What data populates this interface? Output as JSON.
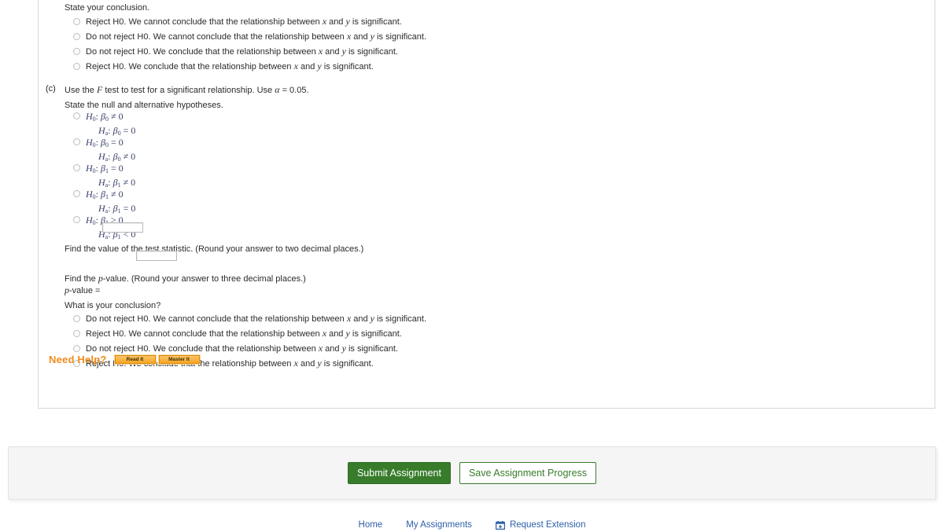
{
  "question": {
    "part_b_prompt": "State your conclusion.",
    "part_b_options": [
      "Reject H0. We cannot conclude that the relationship between x and y is significant.",
      "Do not reject H0. We cannot conclude that the relationship between x and y is significant.",
      "Do not reject H0. We conclude that the relationship between x and y is significant.",
      "Reject H0. We conclude that the relationship between x and y is significant."
    ],
    "part_c_letter": "(c)",
    "part_c_prompt": "Use the F test to test for a significant relationship. Use α = 0.05.",
    "hypotheses_prompt": "State the null and alternative hypotheses.",
    "hypotheses_options": [
      {
        "null": "H0: β0 ≠ 0",
        "alt": "Ha: β0 = 0"
      },
      {
        "null": "H0: β0 = 0",
        "alt": "Ha: β0 ≠ 0"
      },
      {
        "null": "H0: β1 = 0",
        "alt": "Ha: β1 ≠ 0"
      },
      {
        "null": "H0: β1 ≠ 0",
        "alt": "Ha: β1 = 0"
      },
      {
        "null": "H0: β1 ≥ 0",
        "alt": "Ha: β1 < 0"
      }
    ],
    "test_statistic_prompt": "Find the value of the test statistic. (Round your answer to two decimal places.)",
    "test_statistic_value": "",
    "p_value_prompt": "Find the p-value. (Round your answer to three decimal places.)",
    "p_value_label": "p-value =",
    "p_value": "",
    "conclusion_prompt": "What is your conclusion?",
    "conclusion_options": [
      "Do not reject H0. We cannot conclude that the relationship between x and y is significant.",
      "Reject H0. We cannot conclude that the relationship between x and y is significant.",
      "Do not reject H0. We conclude that the relationship between x and y is significant.",
      "Reject H0. We conclude that the relationship between x and y is significant."
    ]
  },
  "help": {
    "label": "Need Help?",
    "read_it": "Read It",
    "master_it": "Master It"
  },
  "actions": {
    "submit": "Submit Assignment",
    "save": "Save Assignment Progress"
  },
  "footer": {
    "home": "Home",
    "my_assignments": "My Assignments",
    "request_extension": "Request Extension",
    "calendar_icon": "calendar-plus-icon"
  },
  "colors": {
    "help_orange": "#f08c1a",
    "submit_green": "#387c2b",
    "link_blue": "#2c5fa8",
    "hypothesis_navy": "#39426b"
  }
}
